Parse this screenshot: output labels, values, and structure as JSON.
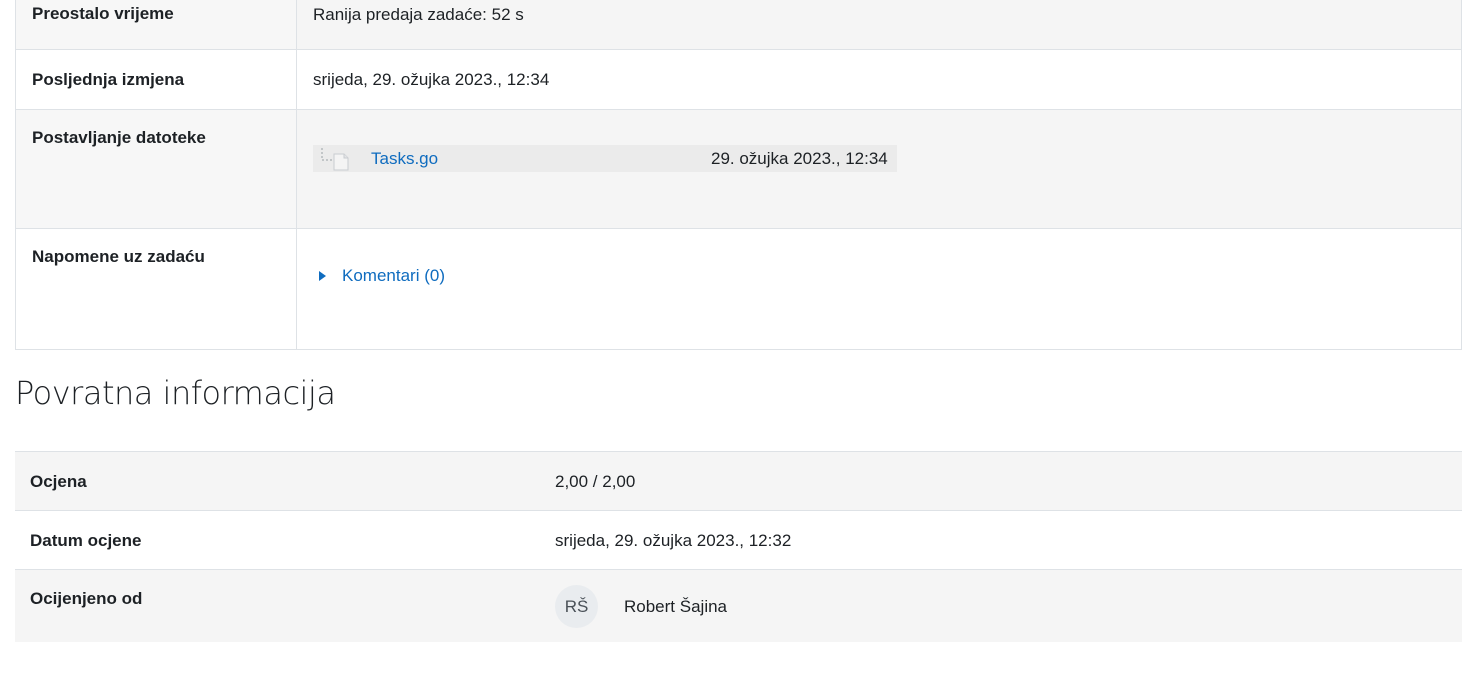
{
  "submission": {
    "rows": [
      {
        "label": "Preostalo vrijeme",
        "value": "Ranija predaja zadaće: 52 s"
      },
      {
        "label": "Posljednja izmjena",
        "value": "srijeda, 29. ožujka 2023., 12:34"
      },
      {
        "label": "Postavljanje datoteke",
        "file_name": "Tasks.go",
        "file_date": "29. ožujka 2023., 12:34"
      },
      {
        "label": "Napomene uz zadaću",
        "comments_label": "Komentari (0)"
      }
    ]
  },
  "feedback": {
    "heading": "Povratna informacija",
    "rows": [
      {
        "label": "Ocjena",
        "value": "2,00 / 2,00"
      },
      {
        "label": "Datum ocjene",
        "value": "srijeda, 29. ožujka 2023., 12:32"
      },
      {
        "label": "Ocijenjeno od",
        "avatar_initials": "RŠ",
        "grader_name": "Robert Šajina"
      }
    ]
  },
  "colors": {
    "success_bg": "#cfefd0",
    "link": "#0f6cbf",
    "row_alt": "#f5f5f5"
  },
  "icons": {
    "file": "file-icon",
    "comments_toggle": "caret-right-icon"
  }
}
